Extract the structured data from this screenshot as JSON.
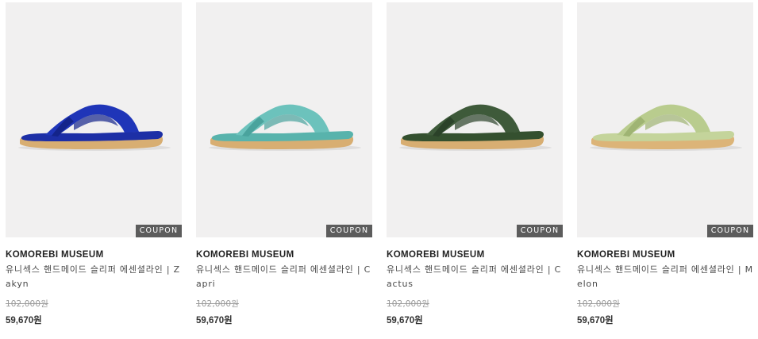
{
  "products": [
    {
      "brand": "KOMOREBI MUSEUM",
      "name": "유니섹스 핸드메이드 슬리퍼 에센셜라인 | Zakyn",
      "original_price": "102,000원",
      "sale_price": "59,670원",
      "badge": "COUPON",
      "strap_color": "#1f35b8",
      "strap_dark": "#14248a",
      "footbed_color": "#1d2fa6",
      "sole_color": "#d8ae72"
    },
    {
      "brand": "KOMOREBI MUSEUM",
      "name": "유니섹스 핸드메이드 슬리퍼 에센셜라인 | Capri",
      "original_price": "102,000원",
      "sale_price": "59,670원",
      "badge": "COUPON",
      "strap_color": "#6cc2bc",
      "strap_dark": "#4aa39d",
      "footbed_color": "#58b3ac",
      "sole_color": "#d8ae72"
    },
    {
      "brand": "KOMOREBI MUSEUM",
      "name": "유니섹스 핸드메이드 슬리퍼 에센셜라인 | Cactus",
      "original_price": "102,000원",
      "sale_price": "59,670원",
      "badge": "COUPON",
      "strap_color": "#3e5a3a",
      "strap_dark": "#2b4229",
      "footbed_color": "#34502f",
      "sole_color": "#d8ae72"
    },
    {
      "brand": "KOMOREBI MUSEUM",
      "name": "유니섹스 핸드메이드 슬리퍼 에센셜라인 | Melon",
      "original_price": "102,000원",
      "sale_price": "59,670원",
      "badge": "COUPON",
      "strap_color": "#b9cc8e",
      "strap_dark": "#9fb473",
      "footbed_color": "#c4d49b",
      "sole_color": "#dcb478"
    }
  ]
}
